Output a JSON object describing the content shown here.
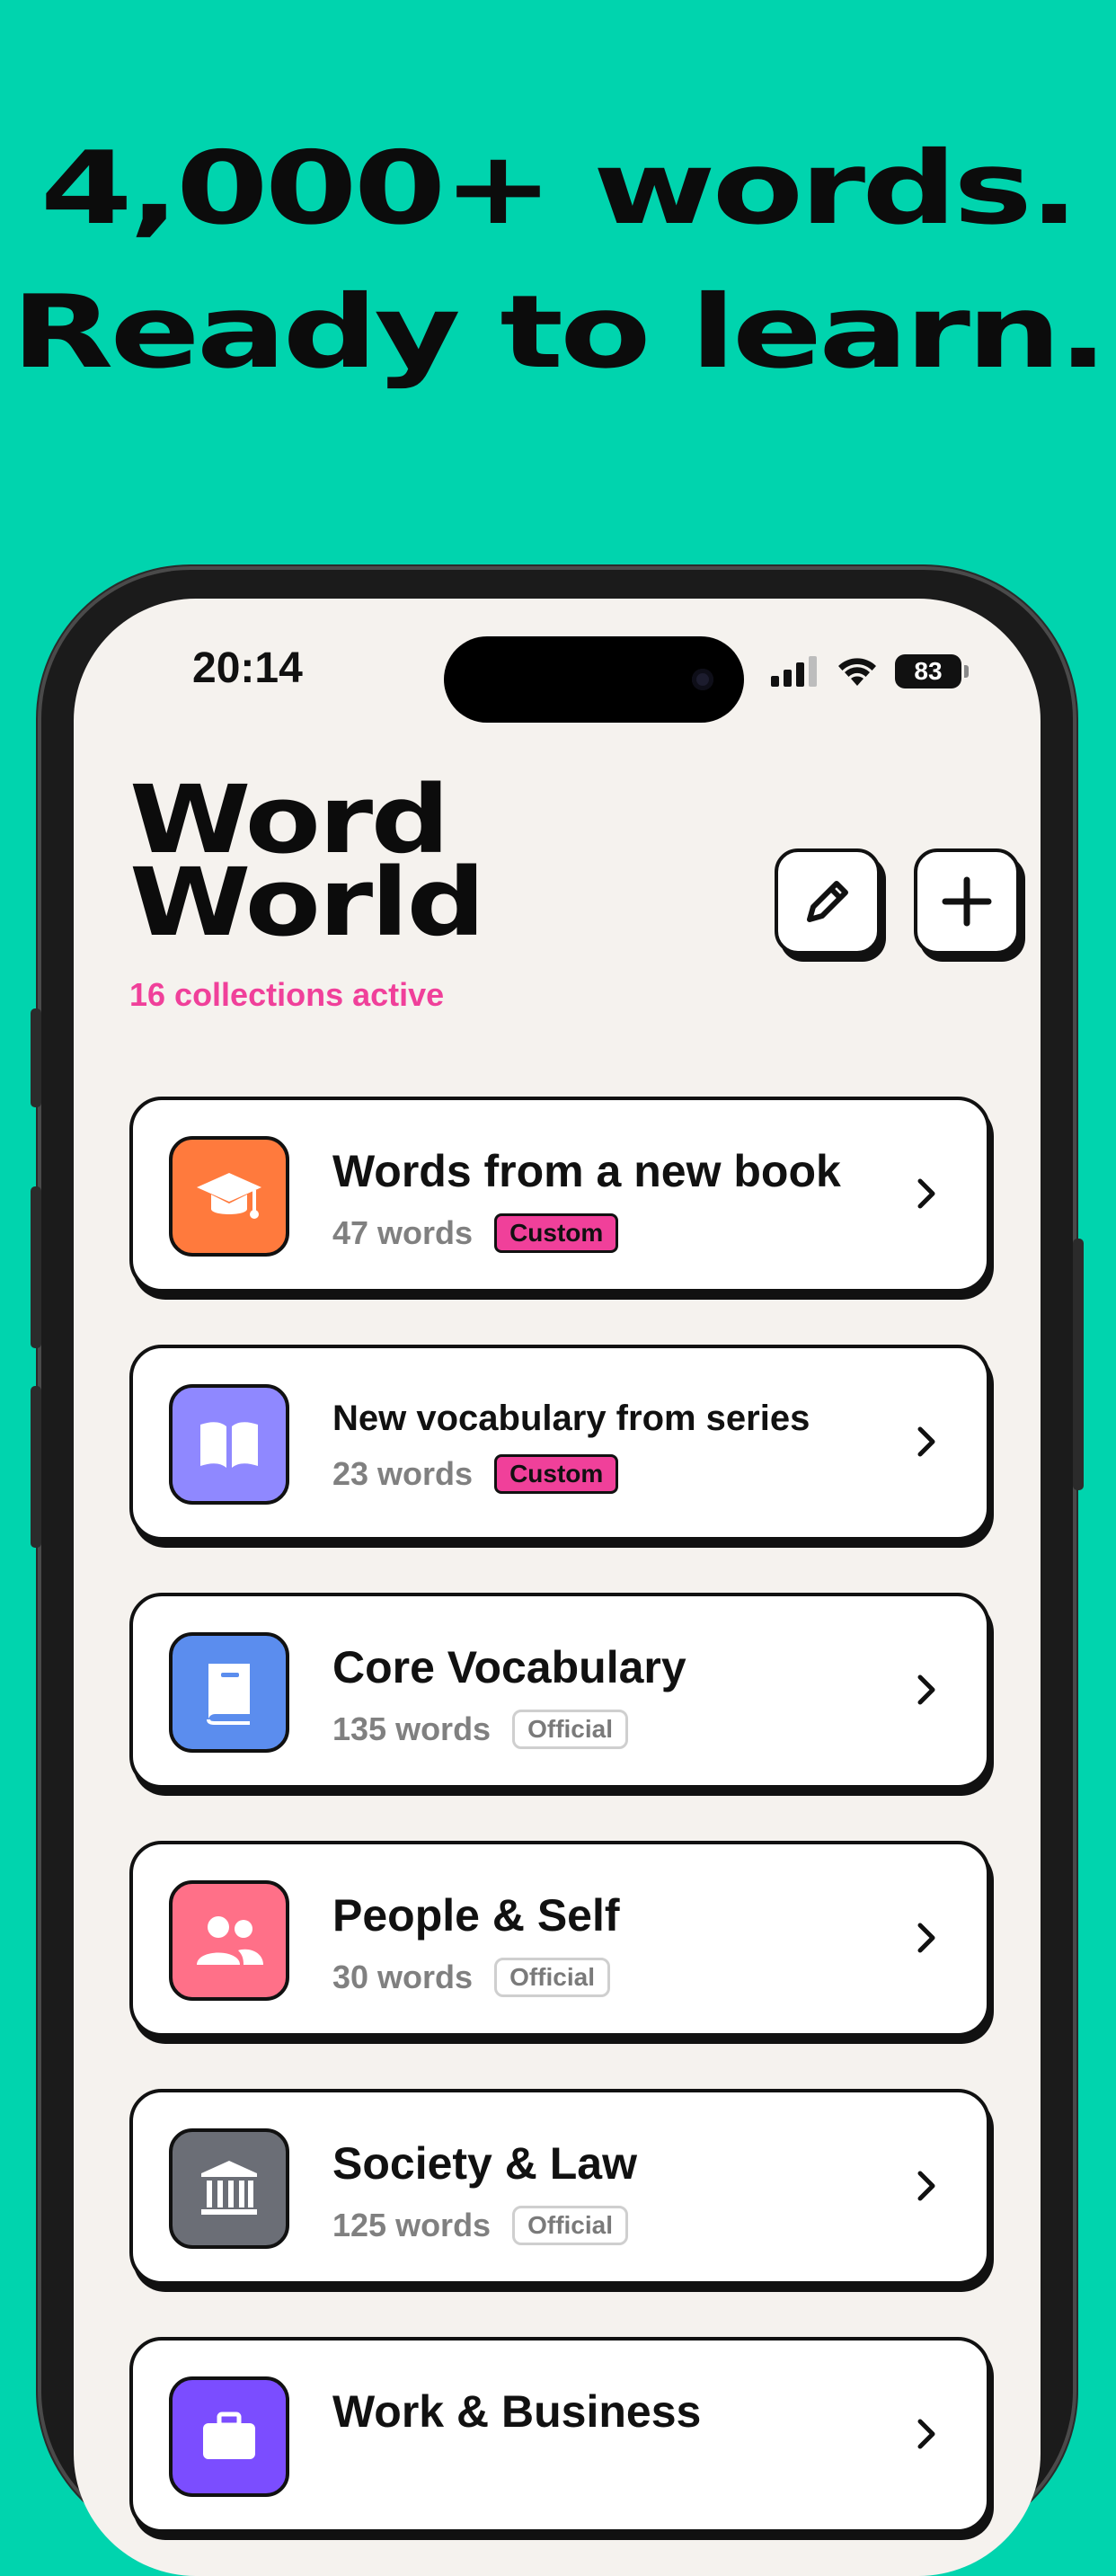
{
  "headline": {
    "line1": "4,000+ words.",
    "line2": "Ready to learn."
  },
  "status_bar": {
    "time": "20:14",
    "battery": "83"
  },
  "header": {
    "title_line1": "Word",
    "title_line2": "World",
    "subtitle": "16 collections active"
  },
  "colors": {
    "background": "#00D4AE",
    "accent_pink": "#F0409A",
    "screen_bg": "#F5F2EE"
  },
  "collections": [
    {
      "title": "Words from a new book",
      "count": "47 words",
      "badge": "Custom",
      "badge_type": "custom",
      "icon": "graduation-cap-icon",
      "icon_color": "#FF7A3D"
    },
    {
      "title": "New vocabulary from series",
      "count": "23 words",
      "badge": "Custom",
      "badge_type": "custom",
      "icon": "open-book-icon",
      "icon_color": "#8F88FF"
    },
    {
      "title": "Core Vocabulary",
      "count": "135 words",
      "badge": "Official",
      "badge_type": "official",
      "icon": "book-icon",
      "icon_color": "#5B8DEE"
    },
    {
      "title": "People & Self",
      "count": "30 words",
      "badge": "Official",
      "badge_type": "official",
      "icon": "people-icon",
      "icon_color": "#FF7088"
    },
    {
      "title": "Society & Law",
      "count": "125 words",
      "badge": "Official",
      "badge_type": "official",
      "icon": "courthouse-icon",
      "icon_color": "#6B6E76"
    },
    {
      "title": "Work & Business",
      "count": "",
      "badge": "",
      "badge_type": "",
      "icon": "briefcase-icon",
      "icon_color": "#7B4DFF"
    }
  ]
}
